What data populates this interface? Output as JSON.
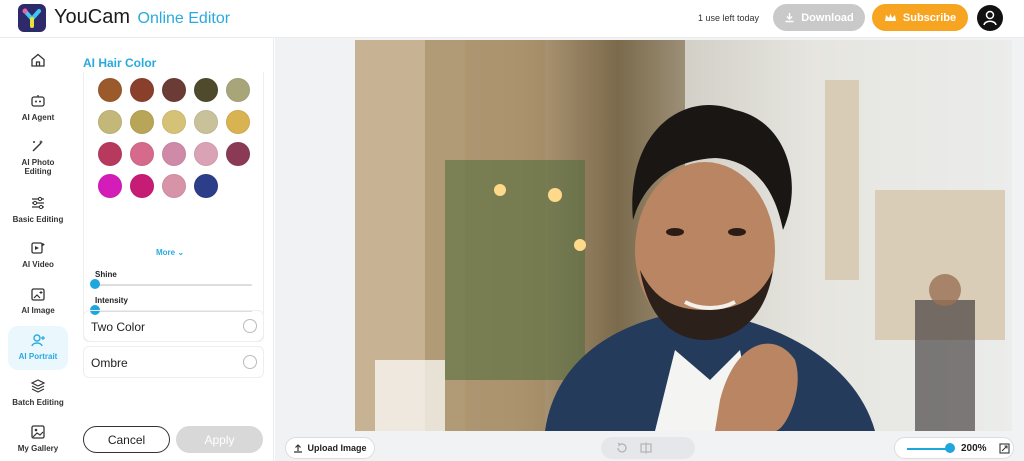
{
  "header": {
    "brand": "YouCam",
    "brand_sub": "Online Editor",
    "uses_left": "1 use left today",
    "download_label": "Download",
    "subscribe_label": "Subscribe"
  },
  "nav": {
    "items": [
      {
        "label": "",
        "icon": "home-icon"
      },
      {
        "label": "AI Agent",
        "icon": "robot-icon"
      },
      {
        "label": "AI Photo Editing",
        "icon": "wand-icon"
      },
      {
        "label": "Basic Editing",
        "icon": "sliders-icon"
      },
      {
        "label": "AI Video",
        "icon": "video-icon"
      },
      {
        "label": "AI Image",
        "icon": "image-plus-icon"
      },
      {
        "label": "AI Portrait",
        "icon": "portrait-icon",
        "active": true
      },
      {
        "label": "Batch Editing",
        "icon": "layers-icon"
      },
      {
        "label": "My Gallery",
        "icon": "gallery-icon"
      }
    ]
  },
  "panel": {
    "title": "AI Hair Color",
    "swatches": [
      "#9a5a2b",
      "#8a3f2c",
      "#6b3b35",
      "#4f4a2c",
      "#a9a57b",
      "#c3b779",
      "#b9a557",
      "#d6c276",
      "#c9c19a",
      "#d9b252",
      "#b73a5e",
      "#d56a8c",
      "#cf8aa8",
      "#d9a3b5",
      "#8b3a55",
      "#d41cb8",
      "#c61c76",
      "#d793a7",
      "#2c3d8a"
    ],
    "more_label": "More",
    "shine_label": "Shine",
    "shine_value": 0,
    "intensity_label": "Intensity",
    "intensity_value": 0,
    "two_color_label": "Two Color",
    "ombre_label": "Ombre",
    "cancel_label": "Cancel",
    "apply_label": "Apply"
  },
  "canvas": {
    "upload_label": "Upload Image",
    "zoom_value": "200%"
  },
  "colors": {
    "accent": "#29aadf",
    "subscribe": "#f7a521"
  }
}
